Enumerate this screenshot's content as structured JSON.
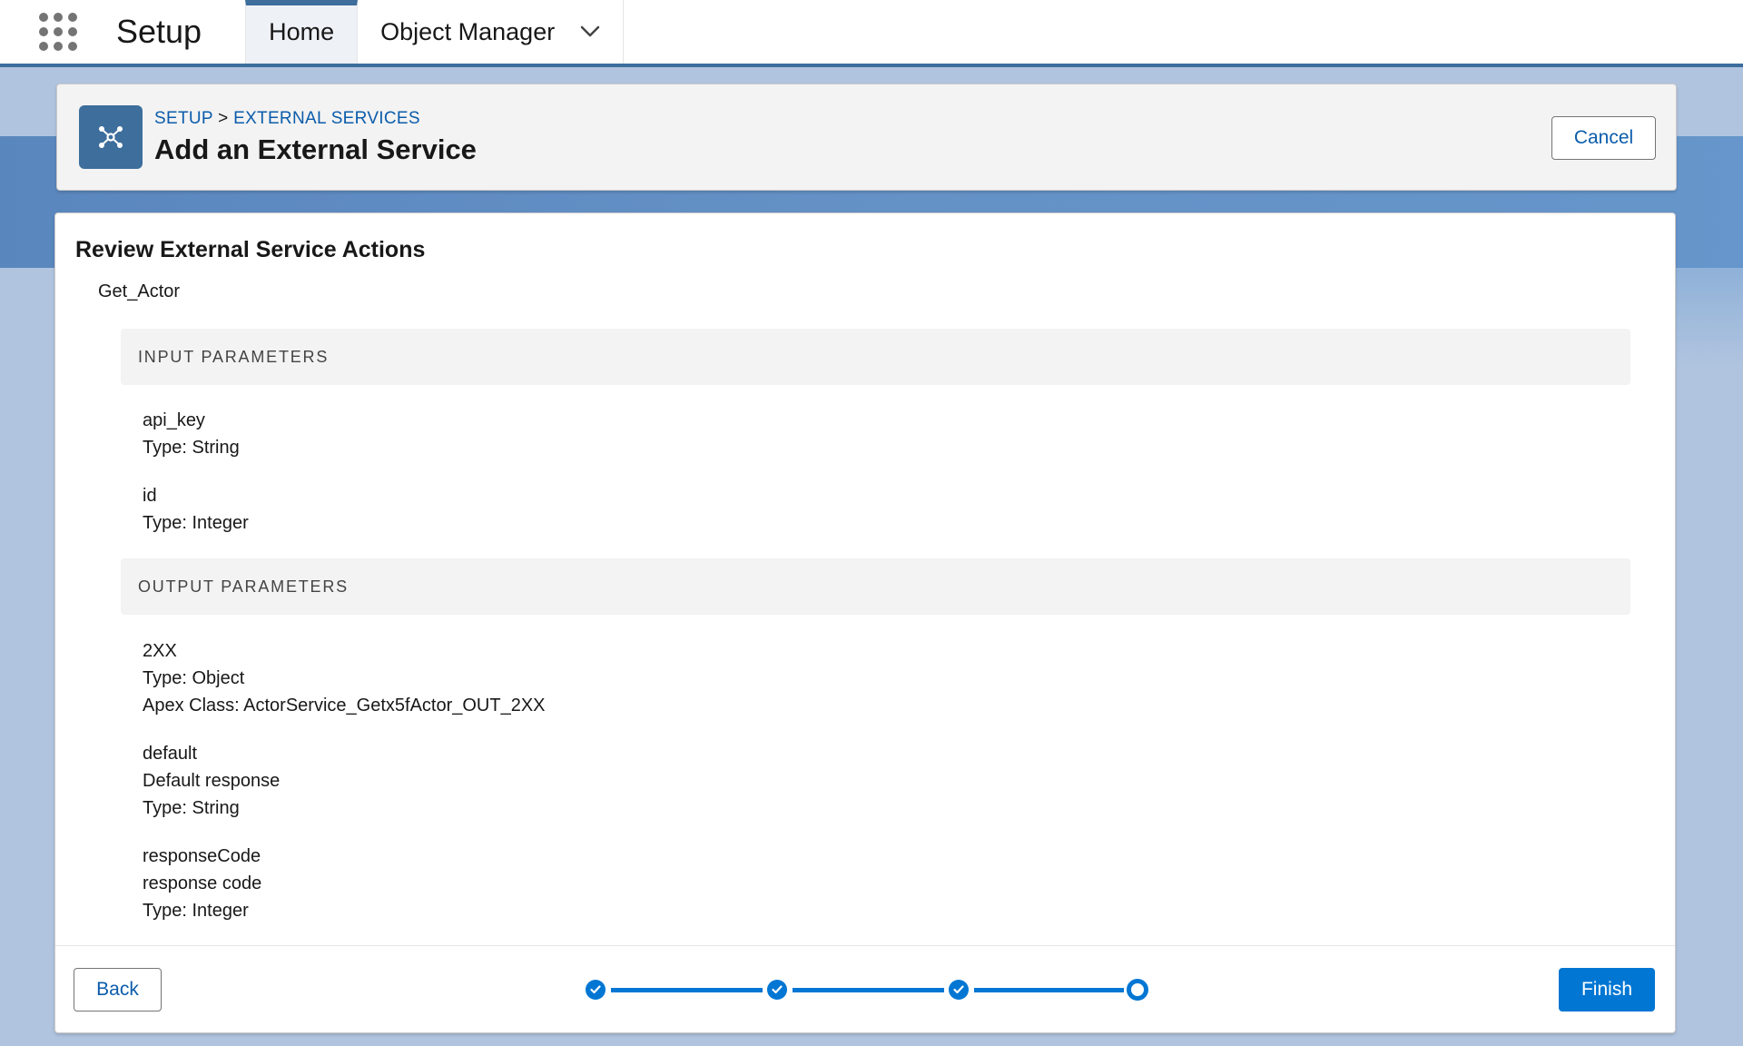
{
  "nav": {
    "app_name": "Setup",
    "tabs": [
      {
        "label": "Home"
      },
      {
        "label": "Object Manager"
      }
    ]
  },
  "header": {
    "breadcrumb_root": "SETUP",
    "breadcrumb_sep": ">",
    "breadcrumb_current": "EXTERNAL SERVICES",
    "title": "Add an External Service",
    "cancel_label": "Cancel"
  },
  "main": {
    "section_title": "Review External Service Actions",
    "action_name": "Get_Actor",
    "input_header": "INPUT PARAMETERS",
    "inputs": [
      {
        "name": "api_key",
        "type": "Type: String"
      },
      {
        "name": "id",
        "type": "Type: Integer"
      }
    ],
    "output_header": "OUTPUT PARAMETERS",
    "outputs": [
      {
        "name": "2XX",
        "type": "Type: Object",
        "extra": "Apex Class: ActorService_Getx5fActor_OUT_2XX"
      },
      {
        "name": "default",
        "description": "Default response",
        "type": "Type: String"
      },
      {
        "name": "responseCode",
        "description": "response code",
        "type": "Type: Integer"
      }
    ]
  },
  "footer": {
    "back_label": "Back",
    "finish_label": "Finish",
    "progress": {
      "total_steps": 4,
      "completed_steps": 3,
      "current_step": 4
    }
  },
  "colors": {
    "brand": "#3d6e9c",
    "primary": "#0176d3",
    "link": "#0b5cab"
  }
}
